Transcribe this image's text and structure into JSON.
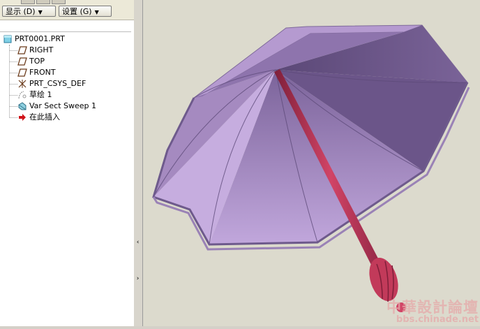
{
  "toolbar": {
    "show_label": "显示 (D)",
    "settings_label": "设置 (G)"
  },
  "tree": {
    "root": "PRT0001.PRT",
    "items": [
      {
        "label": "RIGHT",
        "icon": "datum-plane-icon"
      },
      {
        "label": "TOP",
        "icon": "datum-plane-icon"
      },
      {
        "label": "FRONT",
        "icon": "datum-plane-icon"
      },
      {
        "label": "PRT_CSYS_DEF",
        "icon": "coordinate-system-icon"
      },
      {
        "label": "草绘 1",
        "icon": "sketch-icon"
      },
      {
        "label": "Var Sect Sweep 1",
        "icon": "sweep-feature-icon"
      },
      {
        "label": "在此插入",
        "icon": "insert-here-arrow-icon"
      }
    ]
  },
  "watermark": {
    "cn": "中華設計論壇",
    "en": "bbs.chinade.net"
  },
  "colors": {
    "umbrella_top": "#a98bc6",
    "umbrella_inner": "#6a5488",
    "handle": "#c23a5a"
  }
}
